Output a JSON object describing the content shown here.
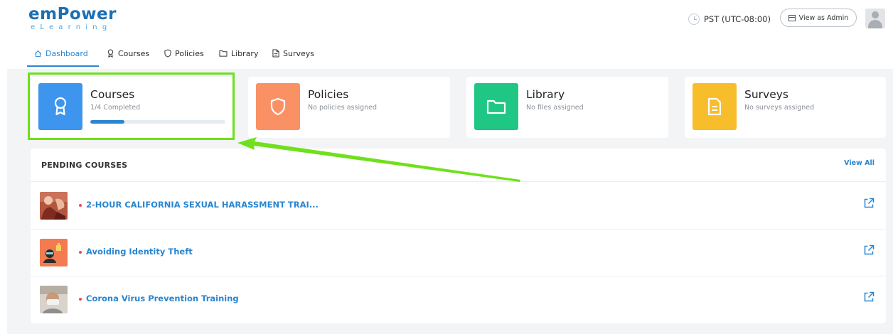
{
  "header": {
    "logo_main": "emPower",
    "logo_sub": "eLearning",
    "timezone": "PST (UTC-08:00)",
    "admin_button": "View as Admin"
  },
  "nav": {
    "items": [
      {
        "label": "Dashboard",
        "icon": "home-icon",
        "active": true
      },
      {
        "label": "Courses",
        "icon": "award-icon"
      },
      {
        "label": "Policies",
        "icon": "shield-icon"
      },
      {
        "label": "Library",
        "icon": "folder-icon"
      },
      {
        "label": "Surveys",
        "icon": "document-icon"
      }
    ]
  },
  "cards": [
    {
      "title": "Courses",
      "subtitle": "1/4 Completed",
      "color": "#3d95ee",
      "icon": "award-icon",
      "progress": 0.25
    },
    {
      "title": "Policies",
      "subtitle": "No policies assigned",
      "color": "#fa9165",
      "icon": "shield-icon"
    },
    {
      "title": "Library",
      "subtitle": "No files assigned",
      "color": "#1fc684",
      "icon": "folder-icon"
    },
    {
      "title": "Surveys",
      "subtitle": "No surveys assigned",
      "color": "#f7bd2b",
      "icon": "document-icon"
    }
  ],
  "pending": {
    "title": "PENDING COURSES",
    "view_all": "View All",
    "courses": [
      {
        "name": "2-HOUR CALIFORNIA SEXUAL HARASSMENT TRAI..."
      },
      {
        "name": "Avoiding Identity Theft"
      },
      {
        "name": "Corona Virus Prevention Training"
      }
    ]
  },
  "colors": {
    "accent": "#2a86d1",
    "highlight": "#6fe01c",
    "bullet": "#e84a5f"
  }
}
